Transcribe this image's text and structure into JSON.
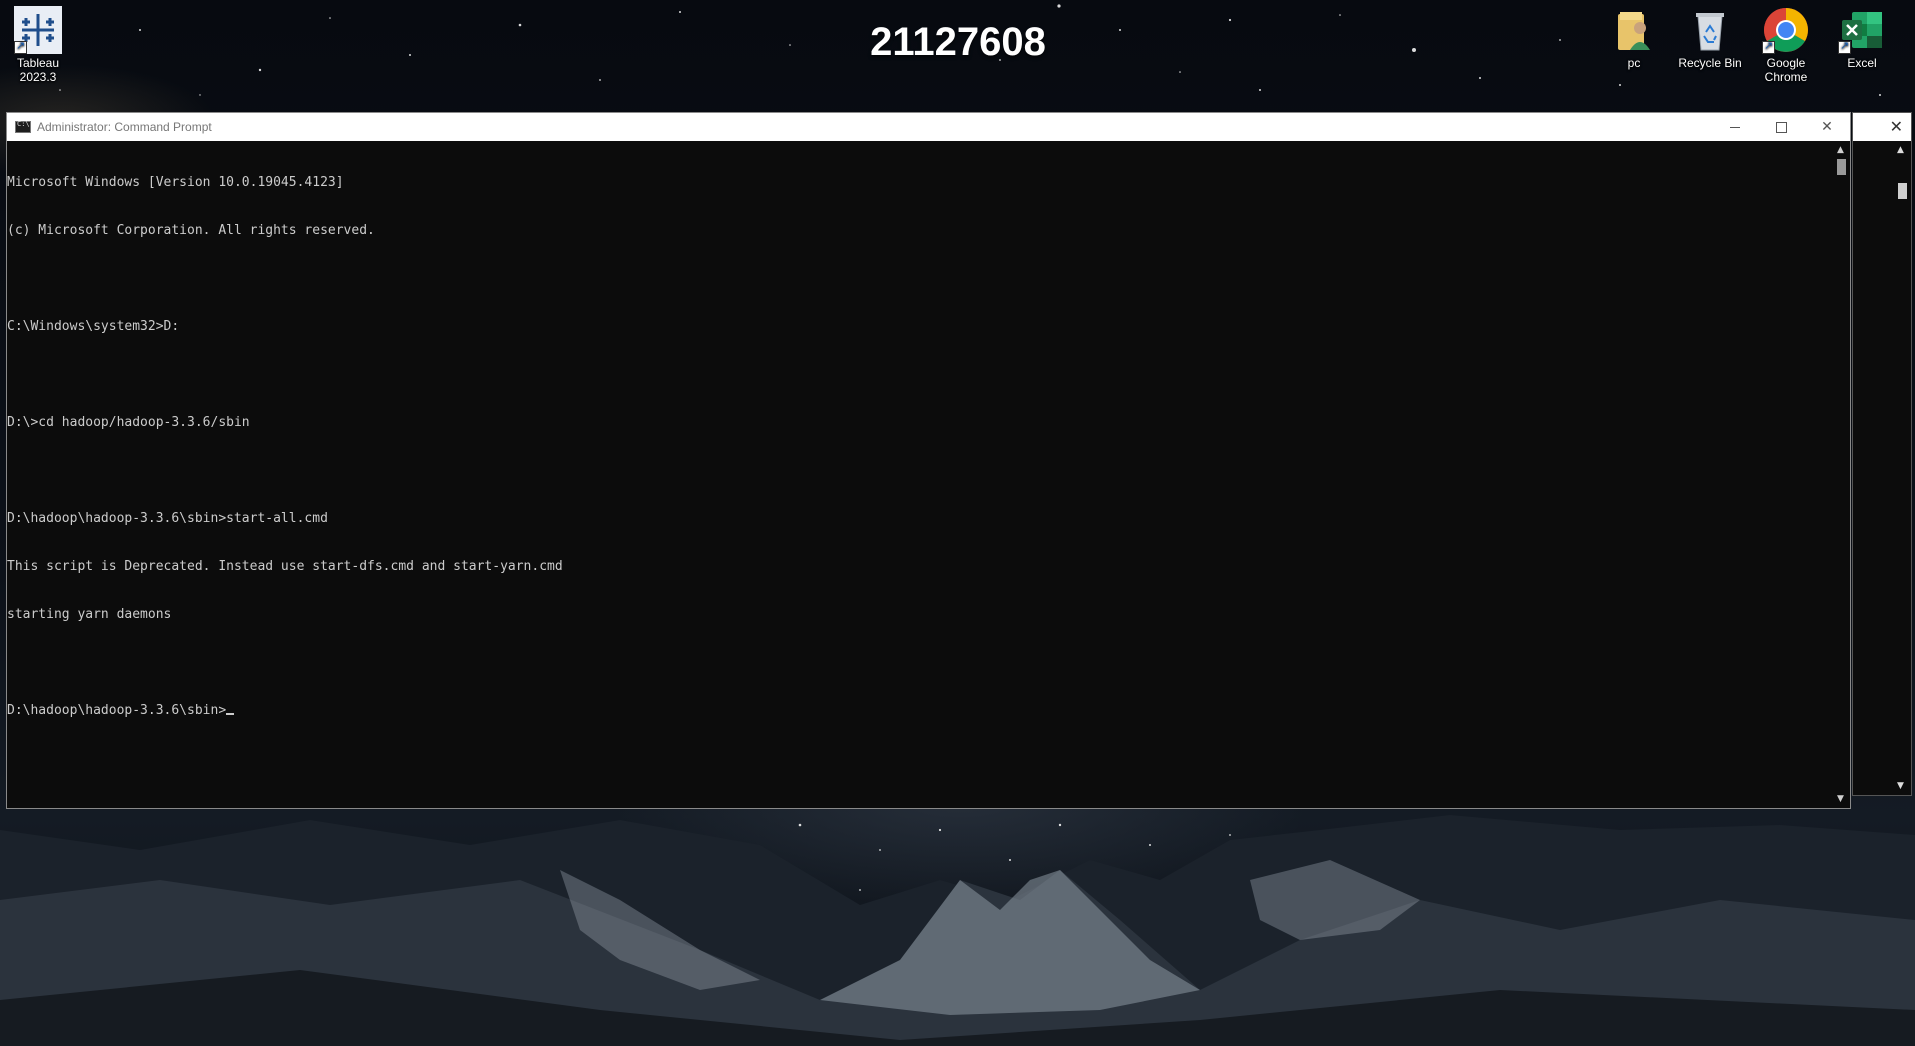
{
  "desktop": {
    "bginfo_text": "21127608",
    "icons_left": [
      {
        "label": "Tableau 2023.3",
        "icon": "tableau-icon"
      }
    ],
    "icons_right": [
      {
        "label": "pc",
        "icon": "user-folder-icon"
      },
      {
        "label": "Recycle Bin",
        "icon": "recycle-bin-icon"
      },
      {
        "label": "Google Chrome",
        "icon": "chrome-icon"
      },
      {
        "label": "Excel",
        "icon": "excel-icon"
      }
    ]
  },
  "window": {
    "title": "Administrator: Command Prompt",
    "icon": "cmd-icon",
    "controls": {
      "minimize": "minimize-icon",
      "maximize": "maximize-icon",
      "close": "close-icon"
    },
    "console_bg": "#0c0c0c",
    "console_fg": "#cccccc",
    "console_lines": [
      "Microsoft Windows [Version 10.0.19045.4123]",
      "(c) Microsoft Corporation. All rights reserved.",
      "",
      "C:\\Windows\\system32>D:",
      "",
      "D:\\>cd hadoop/hadoop-3.3.6/sbin",
      "",
      "D:\\hadoop\\hadoop-3.3.6\\sbin>start-all.cmd",
      "This script is Deprecated. Instead use start-dfs.cmd and start-yarn.cmd",
      "starting yarn daemons",
      ""
    ],
    "prompt": "D:\\hadoop\\hadoop-3.3.6\\sbin>"
  },
  "colors": {
    "titlebar": "#ffffff",
    "excel_green": "#1d6f42",
    "chrome_red": "#db4437",
    "chrome_yellow": "#f4b400",
    "chrome_green": "#0f9d58",
    "chrome_blue": "#4285f4",
    "tableau_blue": "#1f4e8c"
  }
}
